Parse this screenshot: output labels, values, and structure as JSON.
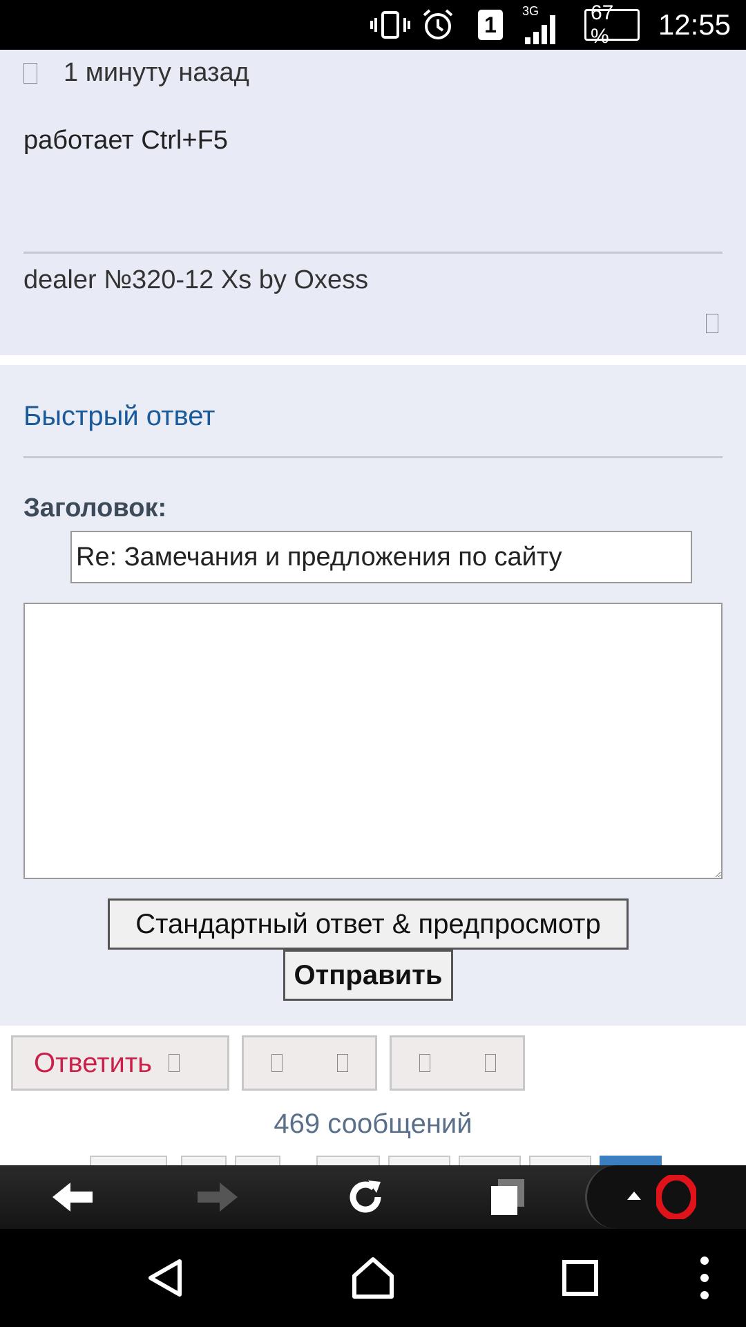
{
  "status_bar": {
    "network": "3G",
    "sim_slot": "1",
    "battery": "67 %",
    "time": "12:55"
  },
  "post": {
    "timestamp": "1 минуту назад",
    "body": "работает Ctrl+F5",
    "signature": "dealer №320-12  Xs by Oxess"
  },
  "quick_reply": {
    "title": "Быстрый ответ",
    "subject_label": "Заголовок:",
    "subject_value": "Re: Замечания и предложения по сайту",
    "message_value": "",
    "advanced_button": "Стандартный ответ & предпросмотр",
    "send_button": "Отправить"
  },
  "actions": {
    "reply_button": "Ответить"
  },
  "message_count": "469 сообщений",
  "colors": {
    "post_bg": "#e8ebf6",
    "link_blue": "#1a5a9a",
    "reply_red": "#cc1f4a",
    "opera_red": "#e0131a"
  },
  "browser_toolbar": {
    "icons": [
      "back-arrow-icon",
      "forward-arrow-icon",
      "reload-icon",
      "tabs-icon",
      "opera-menu-icon"
    ]
  },
  "nav_bar": {
    "icons": [
      "back-triangle-icon",
      "home-icon",
      "recents-icon",
      "overflow-menu-icon"
    ]
  }
}
